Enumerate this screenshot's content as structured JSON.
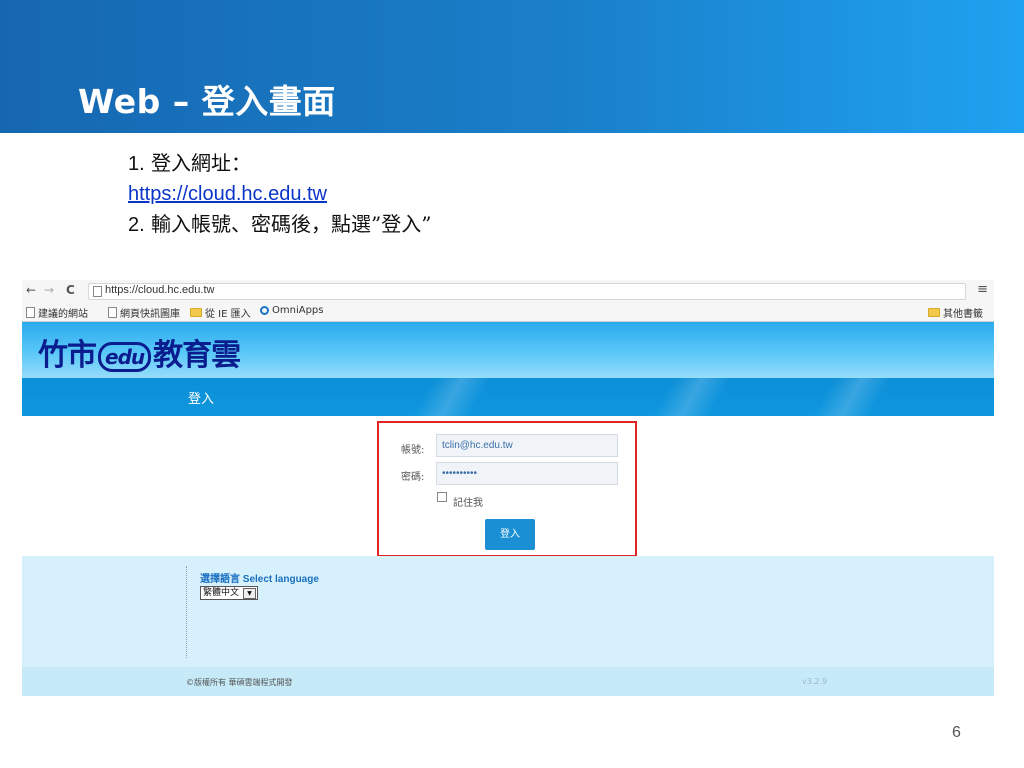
{
  "slide": {
    "title": "Web – 登入畫面",
    "instructions": {
      "step1_num": "1.",
      "step1_text": " 登入網址：",
      "url": "https://cloud.hc.edu.tw",
      "step2_num": "2.",
      "step2_text": " 輸入帳號、密碼後，點選”登入”"
    },
    "page_number": "6"
  },
  "browser": {
    "back_icon": "←",
    "forward_icon": "→",
    "reload_icon": "C",
    "address": "https://cloud.hc.edu.tw",
    "menu_icon": "≡",
    "bookmarks": [
      {
        "label": "建議的網站"
      },
      {
        "label": "網頁快訊圖庫"
      },
      {
        "label": "從 IE 匯入"
      },
      {
        "label": "OmniApps"
      }
    ],
    "other_bookmarks": "其他書籤"
  },
  "site": {
    "logo_left": "竹市",
    "logo_edu": "edu",
    "logo_right": "教育雲",
    "nav_login": "登入",
    "form": {
      "account_label": "帳號:",
      "account_value": "tclin@hc.edu.tw",
      "password_label": "密碼:",
      "password_value": "••••••••••",
      "remember_label": "記住我",
      "login_button": "登入"
    },
    "language": {
      "title": "選擇語言 Select language",
      "selected": "繁體中文"
    },
    "footer": {
      "copyright": "©版權所有 華碩雲端程式開發",
      "version": "v3.2.9"
    }
  },
  "colors": {
    "slide_header": "#1a7fc9",
    "highlight_border": "#e02424",
    "login_button": "#1a8fd4",
    "link": "#0a35c9"
  }
}
